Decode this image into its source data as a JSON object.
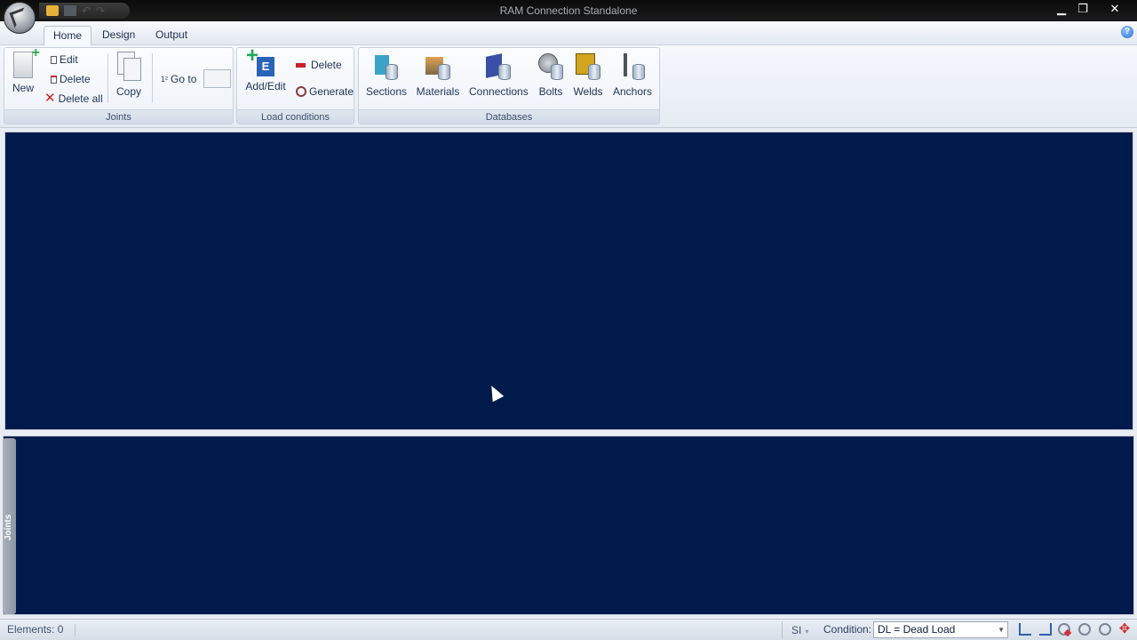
{
  "window": {
    "title": "RAM Connection Standalone",
    "minimize": "▁",
    "maximize": "❐",
    "close": "✕"
  },
  "quick_access": {
    "undo": "↶",
    "redo": "↷"
  },
  "tabs": [
    {
      "label": "Home",
      "active": true
    },
    {
      "label": "Design",
      "active": false
    },
    {
      "label": "Output",
      "active": false
    }
  ],
  "help_glyph": "?",
  "ribbon": {
    "joints": {
      "label": "Joints",
      "new": "New",
      "edit": "Edit",
      "delete": "Delete",
      "delete_all": "Delete all",
      "copy": "Copy",
      "goto": "Go to",
      "goto_value": ""
    },
    "load_conditions": {
      "label": "Load conditions",
      "add_edit": "Add/Edit",
      "add_edit_glyph": "E",
      "delete": "Delete",
      "generate": "Generate"
    },
    "databases": {
      "label": "Databases",
      "items": [
        "Sections",
        "Materials",
        "Connections",
        "Bolts",
        "Welds",
        "Anchors"
      ]
    }
  },
  "joints_panel": {
    "tab_label": "Joints"
  },
  "status": {
    "elements": "Elements: 0",
    "units": "SI",
    "condition_label": "Condition:",
    "condition_value": "DL = Dead Load",
    "icons": [
      "select-icon",
      "pan-icon",
      "zoom-window-icon",
      "zoom-in-icon",
      "zoom-out-icon",
      "move-icon"
    ],
    "move_glyph": "✥"
  },
  "colors": {
    "canvas": "#001b4b",
    "ribbon": "#e6ecf4",
    "accent": "#2a64b8"
  }
}
